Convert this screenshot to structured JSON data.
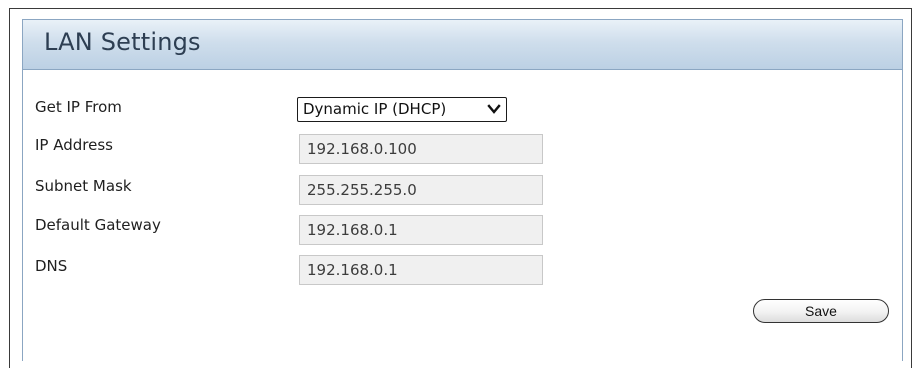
{
  "panel": {
    "title": "LAN Settings"
  },
  "form": {
    "get_ip_from": {
      "label": "Get IP From",
      "selected": "Dynamic IP (DHCP)"
    },
    "ip_address": {
      "label": "IP Address",
      "value": "192.168.0.100"
    },
    "subnet_mask": {
      "label": "Subnet Mask",
      "value": "255.255.255.0"
    },
    "default_gateway": {
      "label": "Default Gateway",
      "value": "192.168.0.1"
    },
    "dns": {
      "label": "DNS",
      "value": "192.168.0.1"
    }
  },
  "actions": {
    "save_label": "Save"
  },
  "icons": {
    "dropdown": "chevron-down-icon"
  }
}
